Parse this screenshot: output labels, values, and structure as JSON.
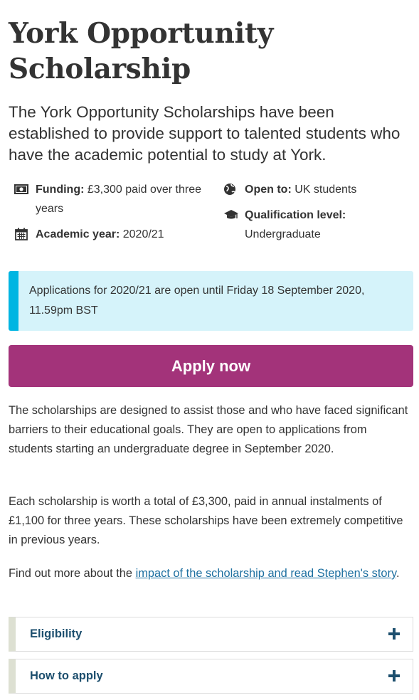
{
  "page": {
    "title": "York Opportunity Scholarship",
    "lead": "The York Opportunity Scholarships have been established to provide support to talented students who have the academic potential to study at York."
  },
  "facts": {
    "funding": {
      "label": "Funding:",
      "value": " £3,300 paid over three years",
      "icon": "banknote-icon"
    },
    "academic_year": {
      "label": "Academic year:",
      "value": " 2020/21",
      "icon": "calendar-icon"
    },
    "open_to": {
      "label": "Open to:",
      "value": " UK students",
      "icon": "globe-icon"
    },
    "qualification": {
      "label": "Qualification level:",
      "value": "Undergraduate",
      "icon": "graduation-cap-icon"
    }
  },
  "alert": {
    "text": "Applications for 2020/21 are open until Friday 18 September 2020, 11.59pm BST",
    "accent": "#00b5e2",
    "background": "#d5f3fa"
  },
  "apply": {
    "label": "Apply now",
    "color": "#a3337a"
  },
  "body": {
    "p1": "The scholarships are designed to assist those and who have faced significant barriers to their educational goals. They are open to applications from students starting an undergraduate degree in September 2020.",
    "p2": "Each scholarship is worth a total of £3,300, paid in annual instalments of £1,100 for three years. These scholarships have been extremely competitive in previous years.",
    "p3_prefix": "Find out more about the ",
    "p3_link": "impact of the scholarship and read Stephen's story",
    "p3_suffix": "."
  },
  "accordion": [
    {
      "label": "Eligibility",
      "icon": "plus-icon"
    },
    {
      "label": "How to apply",
      "icon": "plus-icon"
    }
  ]
}
